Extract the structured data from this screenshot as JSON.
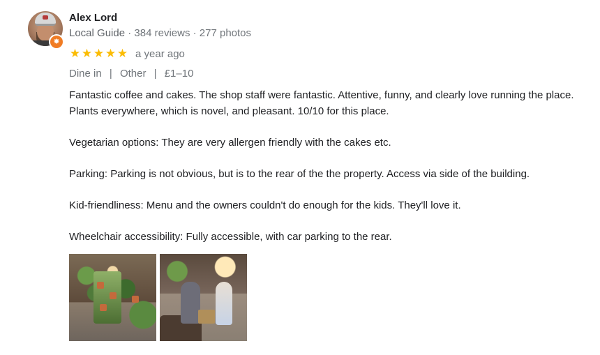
{
  "author": {
    "name": "Alex Lord",
    "role": "Local Guide",
    "reviews": "384 reviews",
    "photos": "277 photos",
    "separator": "·"
  },
  "rating": {
    "stars": 5,
    "max_stars": 5,
    "star_char": "★",
    "star_color": "#fbbc04",
    "time": "a year ago"
  },
  "attributes": {
    "items": [
      "Dine in",
      "Other",
      "£1–10"
    ],
    "separator": "|"
  },
  "body": {
    "paragraphs": [
      "Fantastic coffee and cakes. The shop staff were fantastic. Attentive, funny, and clearly love running the place. Plants everywhere, which is novel, and pleasant. 10/10 for this place.",
      "Vegetarian options: They are very allergen friendly with the cakes etc.",
      "Parking: Parking is not obvious, but is to the rear of the the property. Access via side of the building.",
      "Kid-friendliness: Menu and the owners couldn't do enough for the kids. They'll love it.",
      "Wheelchair accessibility: Fully accessible, with car parking to the rear."
    ]
  },
  "badge": {
    "icon": "local-guide-star-icon",
    "glyph": "✸",
    "color": "#f07c24"
  },
  "photos": [
    {
      "icon": "cafe-plants-photo"
    },
    {
      "icon": "cafe-interior-photo"
    }
  ]
}
